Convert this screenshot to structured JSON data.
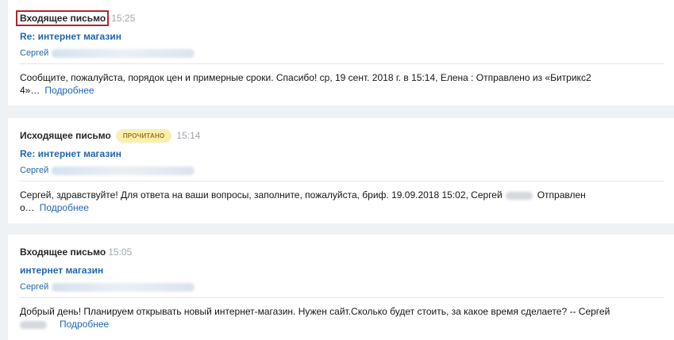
{
  "messages": [
    {
      "type": "Входящее письмо",
      "time": "15:25",
      "badge": "",
      "subject": "Re: интернет магазин",
      "sender": "Сергей",
      "preview_line1": "Сообщите, пожалуйста, порядок цен и примерные сроки. Спасибо! ср, 19 сент. 2018 г. в 15:14, Елена : Отправлено из «Битрикс2",
      "preview_line2": "4»…",
      "more_label": "Подробнее"
    },
    {
      "type": "Исходящее письмо",
      "time": "15:14",
      "badge": "ПРОЧИТАНО",
      "subject": "Re: интернет магазин",
      "sender": "Сергей",
      "preview_line1_a": "Сергей, здравствуйте! Для ответа на ваши вопросы, заполните, пожалуйста, бриф. 19.09.2018 15:02, Сергей",
      "preview_line1_b": "Отправлен",
      "preview_line2": "о…",
      "more_label": "Подробнее"
    },
    {
      "type": "Входящее письмо",
      "time": "15:05",
      "badge": "",
      "subject": "интернет магазин",
      "sender": "Сергей",
      "preview_line1": "Добрый день! Планируем открывать новый интернет-магазин. Нужен сайт.Сколько будет стоить, за какое время сделаете? -- Сергей",
      "more_label": "Подробнее"
    }
  ],
  "colors": {
    "link": "#2066b0",
    "badge_bg": "#fbeeb1",
    "badge_text": "#9b7a1a",
    "highlight_frame": "#b3242b",
    "time": "#a0a7ae"
  }
}
